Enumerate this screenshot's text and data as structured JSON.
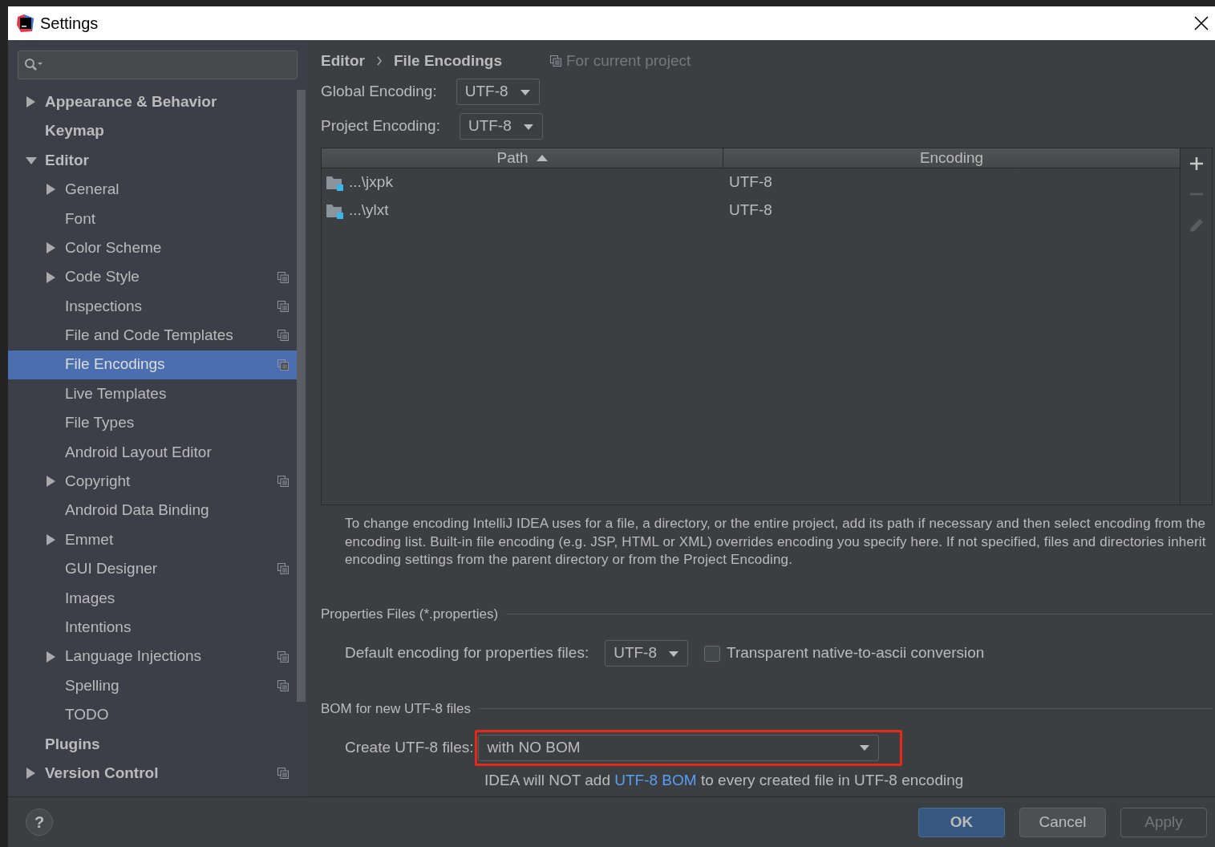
{
  "window": {
    "title": "Settings"
  },
  "sidebar": {
    "items": [
      {
        "label": "Appearance & Behavior",
        "expanded": false,
        "project_scoped": false,
        "selected": false
      },
      {
        "label": "Keymap",
        "project_scoped": false,
        "selected": false
      },
      {
        "label": "Editor",
        "expanded": true,
        "project_scoped": false,
        "selected": false,
        "children": [
          {
            "label": "General",
            "expanded": false,
            "project_scoped": false,
            "selected": false
          },
          {
            "label": "Font",
            "project_scoped": false,
            "selected": false
          },
          {
            "label": "Color Scheme",
            "expanded": false,
            "project_scoped": false,
            "selected": false
          },
          {
            "label": "Code Style",
            "expanded": false,
            "project_scoped": true,
            "selected": false
          },
          {
            "label": "Inspections",
            "project_scoped": true,
            "selected": false
          },
          {
            "label": "File and Code Templates",
            "project_scoped": true,
            "selected": false
          },
          {
            "label": "File Encodings",
            "project_scoped": true,
            "selected": true
          },
          {
            "label": "Live Templates",
            "project_scoped": false,
            "selected": false
          },
          {
            "label": "File Types",
            "project_scoped": false,
            "selected": false
          },
          {
            "label": "Android Layout Editor",
            "project_scoped": false,
            "selected": false
          },
          {
            "label": "Copyright",
            "expanded": false,
            "project_scoped": true,
            "selected": false
          },
          {
            "label": "Android Data Binding",
            "project_scoped": false,
            "selected": false
          },
          {
            "label": "Emmet",
            "expanded": false,
            "project_scoped": false,
            "selected": false
          },
          {
            "label": "GUI Designer",
            "project_scoped": true,
            "selected": false
          },
          {
            "label": "Images",
            "project_scoped": false,
            "selected": false
          },
          {
            "label": "Intentions",
            "project_scoped": false,
            "selected": false
          },
          {
            "label": "Language Injections",
            "expanded": false,
            "project_scoped": true,
            "selected": false
          },
          {
            "label": "Spelling",
            "project_scoped": true,
            "selected": false
          },
          {
            "label": "TODO",
            "project_scoped": false,
            "selected": false
          }
        ]
      },
      {
        "label": "Plugins",
        "project_scoped": false,
        "selected": false
      },
      {
        "label": "Version Control",
        "expanded": false,
        "project_scoped": true,
        "selected": false
      }
    ]
  },
  "breadcrumb": [
    "Editor",
    "File Encodings"
  ],
  "scope_note": "For current project",
  "encodings": [
    {
      "label": "Global Encoding:",
      "value": "UTF-8"
    },
    {
      "label": "Project Encoding:",
      "value": "UTF-8"
    }
  ],
  "table": {
    "columns": [
      {
        "label": "Path",
        "sorted": true
      },
      {
        "label": "Encoding",
        "sorted": false
      }
    ],
    "rows": [
      {
        "path": "...\\jxpk",
        "encoding": "UTF-8"
      },
      {
        "path": "...\\ylxt",
        "encoding": "UTF-8"
      }
    ]
  },
  "toolbar": [
    {
      "kind": "add",
      "disabled": false
    },
    {
      "kind": "remove",
      "disabled": true
    },
    {
      "kind": "edit",
      "disabled": true
    }
  ],
  "description": "To change encoding IntelliJ IDEA uses for a file, a directory, or the entire project, add its path if necessary and then select encoding from the encoding list. Built-in file encoding (e.g. JSP, HTML or XML) overrides encoding you specify here. If not specified, files and directories inherit encoding settings from the parent directory or from the Project Encoding.",
  "properties_files": {
    "title": "Properties Files (*.properties)",
    "label": "Default encoding for properties files:",
    "value": "UTF-8",
    "checkbox": {
      "label": "Transparent native-to-ascii conversion",
      "checked": false
    }
  },
  "bom": {
    "title": "BOM for new UTF-8 files",
    "label": "Create UTF-8 files:",
    "value": "with NO BOM",
    "highlighted": true,
    "hint_before": "IDEA will NOT add ",
    "hint_link": "UTF-8 BOM",
    "hint_after": " to every created file in UTF-8 encoding"
  },
  "help_button": "?",
  "buttons": [
    {
      "label": "OK",
      "kind": "primary",
      "disabled": false
    },
    {
      "label": "Cancel",
      "kind": "default",
      "disabled": false
    },
    {
      "label": "Apply",
      "kind": "default",
      "disabled": true
    }
  ]
}
